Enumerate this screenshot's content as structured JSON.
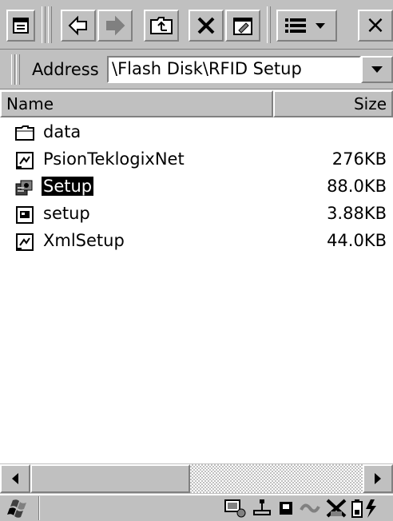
{
  "toolbar": {
    "buttons": [
      {
        "name": "menu-icon"
      },
      {
        "name": "back-arrow-icon"
      },
      {
        "name": "forward-arrow-icon"
      },
      {
        "name": "up-folder-icon"
      },
      {
        "name": "delete-x-icon"
      },
      {
        "name": "properties-icon"
      },
      {
        "name": "view-mode-icon"
      },
      {
        "name": "close-icon",
        "label": "×"
      }
    ]
  },
  "address": {
    "label": "Address",
    "value": "\\Flash Disk\\RFID Setup"
  },
  "columns": {
    "name": "Name",
    "size": "Size"
  },
  "files": [
    {
      "name": "data",
      "size": "",
      "icon": "folder-icon",
      "selected": false
    },
    {
      "name": "PsionTeklogixNet",
      "size": "276KB",
      "icon": "document-file-icon",
      "selected": false
    },
    {
      "name": "Setup",
      "size": "88.0KB",
      "icon": "setup-application-icon",
      "selected": true
    },
    {
      "name": "setup",
      "size": "3.88KB",
      "icon": "script-file-icon",
      "selected": false
    },
    {
      "name": "XmlSetup",
      "size": "44.0KB",
      "icon": "document-file-icon",
      "selected": false
    }
  ],
  "scrollbar": {
    "position": 0
  },
  "taskbar": {
    "tray_icons": [
      "device-status-icon",
      "network-icon",
      "memory-card-icon",
      "connection-icon",
      "no-signal-icon",
      "battery-charging-icon"
    ]
  }
}
